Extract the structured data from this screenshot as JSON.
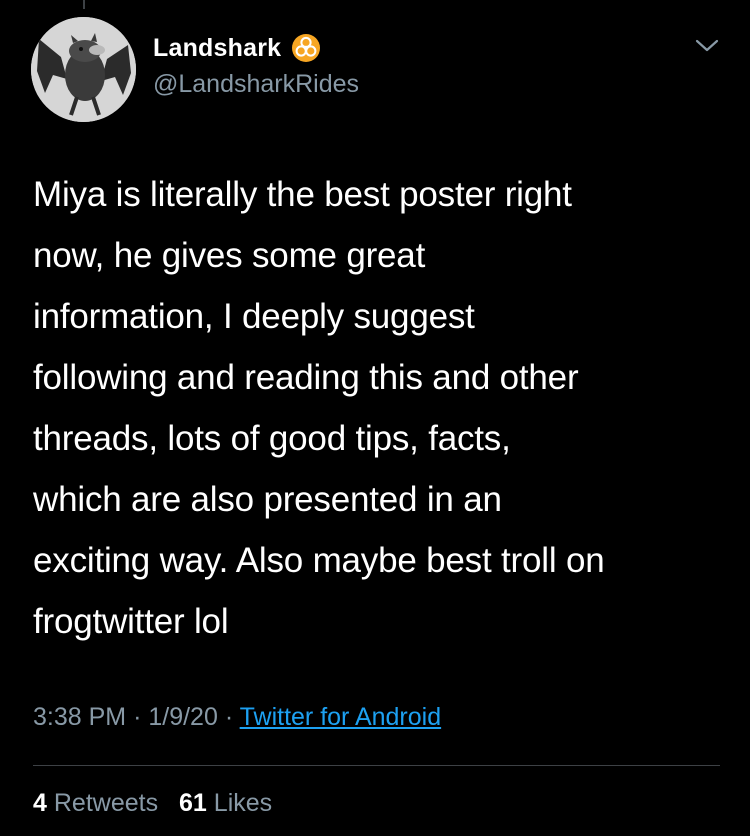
{
  "tweet": {
    "author": {
      "display_name": "Landshark",
      "handle": "@LandsharkRides",
      "badge_icon": "biohazard-icon",
      "badge_color": "#f7a623",
      "avatar_icon": "bat-avatar-icon"
    },
    "menu_icon": "chevron-down-icon",
    "text": "Miya is literally the best poster right\nnow, he gives some great\ninformation, I deeply suggest\nfollowing and reading this and other\nthreads, lots of good tips, facts,\nwhich are also presented in an\nexciting way. Also maybe best troll on\nfrogtwitter lol",
    "time": "3:38 PM",
    "date": "1/9/20",
    "separator": "·",
    "source": "Twitter for Android",
    "retweets_count": "4",
    "retweets_label": "Retweets",
    "likes_count": "61",
    "likes_label": "Likes"
  },
  "colors": {
    "background": "#000000",
    "primary_text": "#ffffff",
    "secondary_text": "#8899a6",
    "link": "#1da1f2",
    "divider": "#3d4145"
  }
}
